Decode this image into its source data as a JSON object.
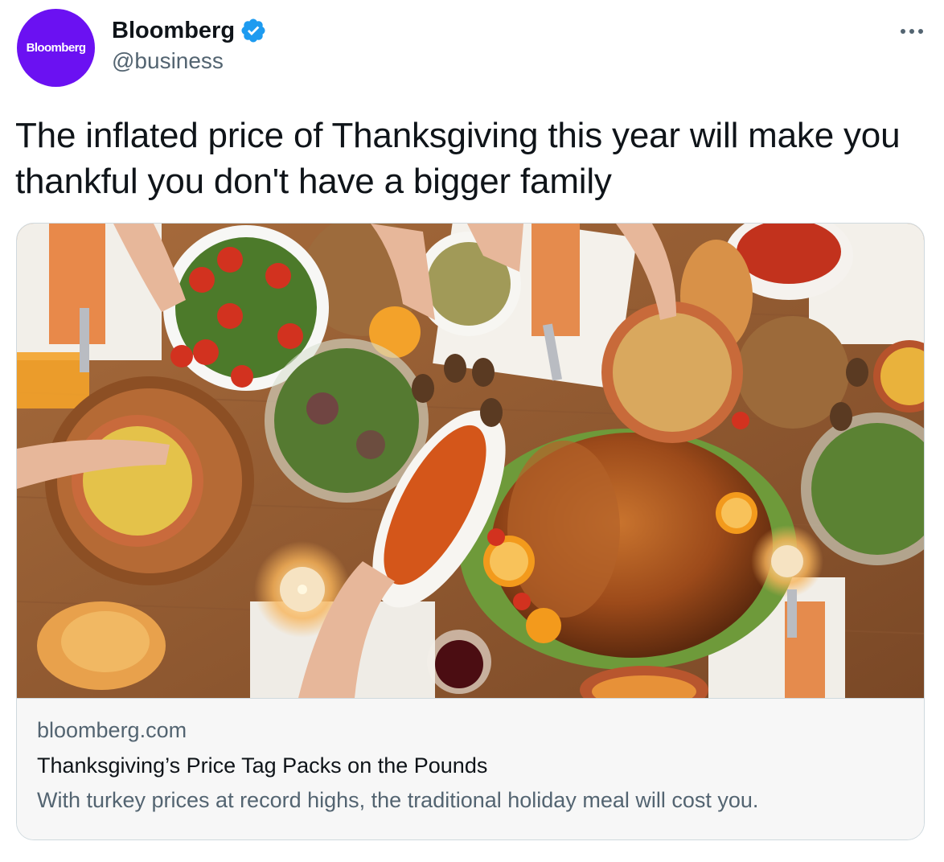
{
  "author": {
    "avatar_text": "Bloomberg",
    "avatar_color": "#6b11f2",
    "display_name": "Bloomberg",
    "handle": "@business",
    "verified": true,
    "verified_color": "#1d9bf0"
  },
  "menu": {
    "icon": "more-horizontal-icon"
  },
  "tweet": {
    "text": "The inflated price of Thanksgiving this year will make you thankful you don't have a bigger family"
  },
  "card": {
    "image_icon": "thanksgiving-dinner-photo",
    "domain": "bloomberg.com",
    "title": "Thanksgiving’s Price Tag Packs on the Pounds",
    "description": "With turkey prices at record highs, the traditional holiday meal will cost you."
  },
  "colors": {
    "text_primary": "#0f1419",
    "text_secondary": "#536471",
    "border": "#cfd9de",
    "card_footer_bg": "#f7f7f7"
  }
}
